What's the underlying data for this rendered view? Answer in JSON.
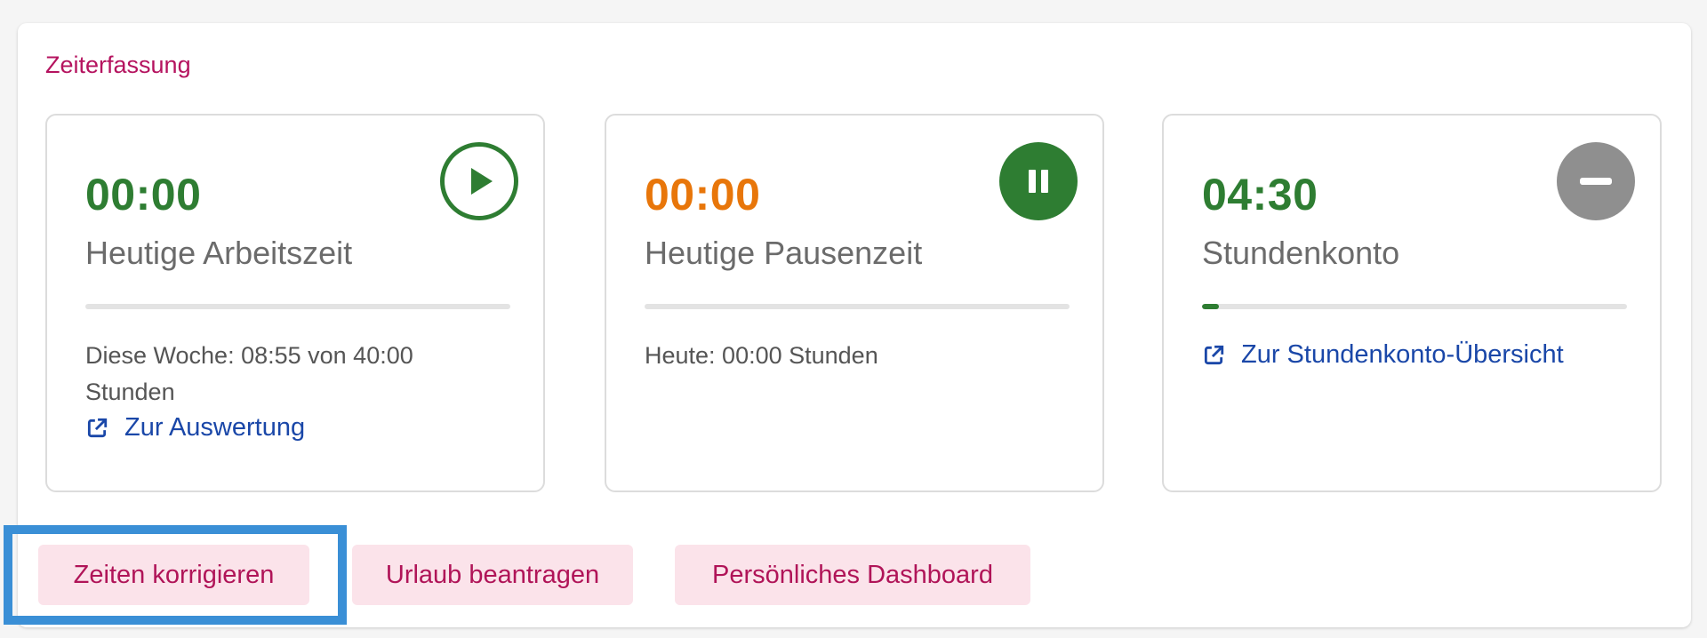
{
  "section": {
    "title": "Zeiterfassung"
  },
  "cards": {
    "work": {
      "value": "00:00",
      "label": "Heutige Arbeitszeit",
      "info": "Diese Woche: 08:55 von 40:00 Stunden",
      "link": "Zur Auswertung",
      "progress": 0,
      "status_icon": "play-icon",
      "color": "#2e7d32"
    },
    "pause": {
      "value": "00:00",
      "label": "Heutige Pausenzeit",
      "info": "Heute: 00:00 Stunden",
      "progress": 0,
      "status_icon": "pause-icon",
      "color": "#e8760a"
    },
    "balance": {
      "value": "04:30",
      "label": "Stundenkonto",
      "link": "Zur Stundenkonto-Übersicht",
      "progress": 0.04,
      "status_icon": "minus-icon",
      "color": "#2e7d32"
    }
  },
  "actions": {
    "correct": "Zeiten korrigieren",
    "vacation": "Urlaub beantragen",
    "dashboard": "Persönliches Dashboard"
  },
  "colors": {
    "accent": "#b5135f",
    "button_bg": "#fbe3ea",
    "link": "#1a47a8",
    "green": "#2e7d32",
    "orange": "#e8760a",
    "gray_status": "#8f8f8f",
    "focus": "#3a8fd6"
  }
}
